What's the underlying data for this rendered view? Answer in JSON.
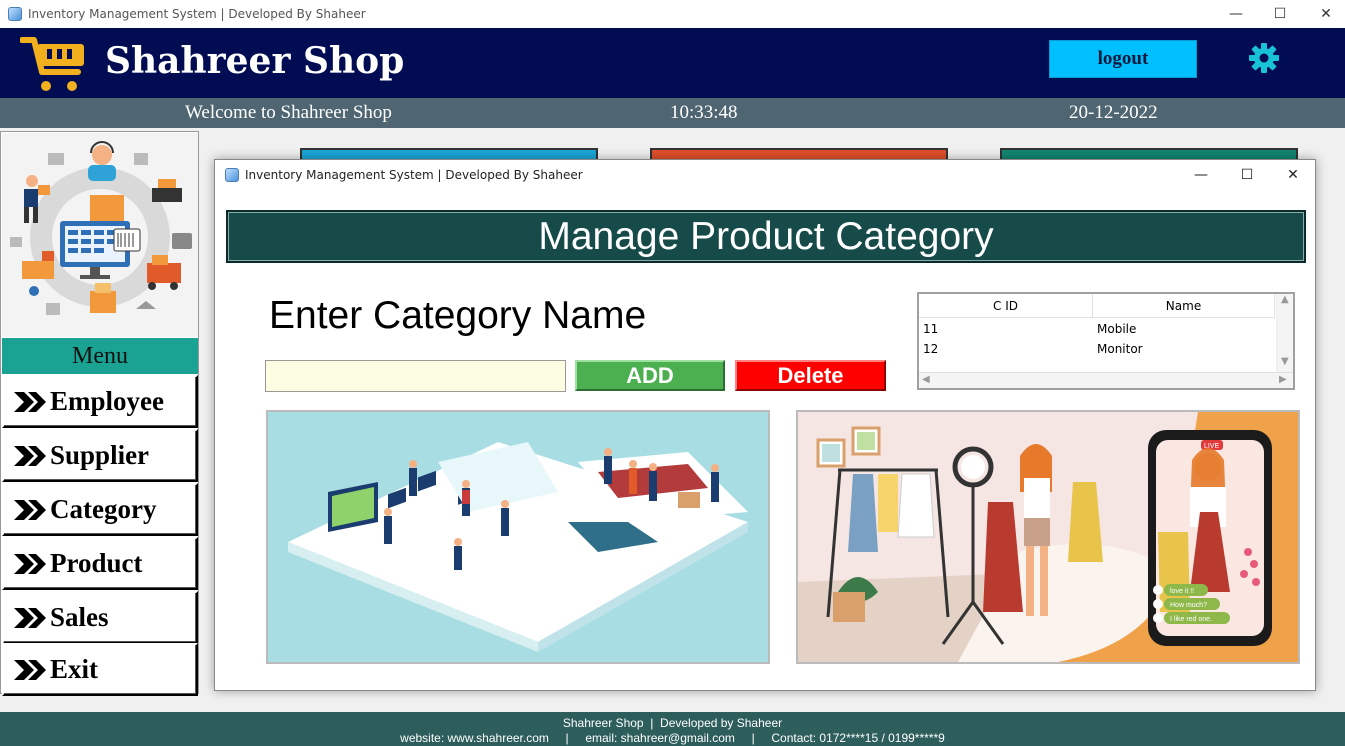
{
  "window": {
    "title": "Inventory Management System | Developed By Shaheer",
    "minimize": "—",
    "maximize": "☐",
    "close": "✕"
  },
  "header": {
    "shop_name": "Shahreer Shop",
    "logout_label": "logout",
    "accent": "#00bfff",
    "bg": "#010c52"
  },
  "statusbar": {
    "welcome": "Welcome to Shahreer Shop",
    "time": "10:33:48",
    "date": "20-12-2022"
  },
  "sidebar": {
    "menu_title": "Menu",
    "items": [
      {
        "label": "Employee"
      },
      {
        "label": "Supplier"
      },
      {
        "label": "Category"
      },
      {
        "label": "Product"
      },
      {
        "label": "Sales"
      },
      {
        "label": "Exit"
      }
    ]
  },
  "child_window": {
    "title": "Inventory Management System | Developed By Shaheer",
    "banner": "Manage Product Category",
    "enter_label": "Enter Category Name",
    "input_value": "",
    "add_label": "ADD",
    "delete_label": "Delete",
    "table": {
      "columns": [
        "C ID",
        "Name"
      ],
      "rows": [
        {
          "cid": "11",
          "name": "Mobile"
        },
        {
          "cid": "12",
          "name": "Monitor"
        }
      ]
    },
    "bubbles": [
      "love it !!",
      "How much?",
      "I like red one."
    ],
    "live_badge": "LIVE"
  },
  "footer": {
    "line1": "Shahreer Shop  |  Developed by Shaheer",
    "line2": "website: www.shahreer.com     |     email: shahreer@gmail.com     |     Contact: 0172****15 / 0199*****9"
  }
}
